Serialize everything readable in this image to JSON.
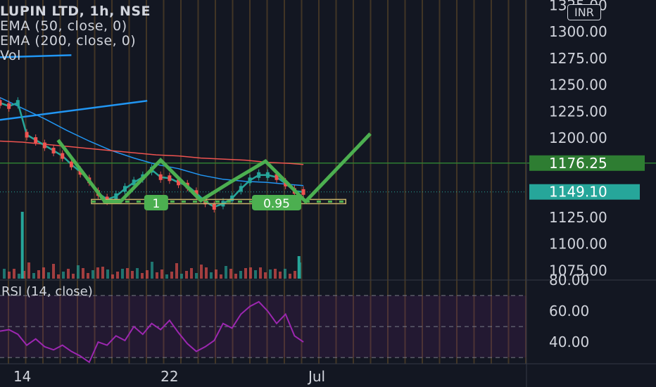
{
  "header": {
    "title": "LUPIN LTD, 1h, NSE",
    "indicators": [
      "EMA (50, close, 0)",
      "EMA (200, close, 0)",
      "Vol"
    ],
    "currency": "INR"
  },
  "rsi": {
    "label": "RSI (14, close)"
  },
  "chart_data": [
    {
      "type": "candlestick",
      "symbol": "LUPIN LTD",
      "interval": "1h",
      "exchange": "NSE",
      "currency": "INR",
      "x_ticks": [
        {
          "x": 0.2,
          "label": "14"
        },
        {
          "x": 3.5,
          "label": "22"
        },
        {
          "x": 6.8,
          "label": "Jul"
        }
      ],
      "xlim": [
        -0.3,
        11.5
      ],
      "ylim": [
        1066,
        1330
      ],
      "y_ticks": [
        1075,
        1100,
        1125,
        1150,
        1175,
        1200,
        1225,
        1250,
        1275,
        1300
      ],
      "y_tick_labels": [
        "1075.00",
        "1100.00",
        "1125.00",
        "1150.00",
        "1175.00",
        "1200.00",
        "1225.00",
        "1250.00",
        "1275.00",
        "1300.00"
      ],
      "partial_top_tick": {
        "value": 1325,
        "label": "1325.00"
      },
      "last_price": {
        "value": 1149.1,
        "label": "1149.10",
        "color": "#26a69a"
      },
      "resistance_line": {
        "value": 1176.25,
        "label": "1176.25",
        "color": "#2e7d32"
      },
      "series": [
        {
          "name": "EMA (50, close, 0)",
          "color": "#2196f3",
          "x": [
            -0.3,
            0.2,
            0.7,
            1.2,
            1.7,
            2.2,
            2.7,
            3.2,
            3.7,
            4.2,
            4.7,
            5.2,
            5.7,
            6.2,
            6.5
          ],
          "values": [
            1238,
            1228,
            1218,
            1207,
            1197,
            1188,
            1181,
            1175,
            1171,
            1165,
            1161,
            1159,
            1158,
            1156,
            1155
          ]
        },
        {
          "name": "EMA (200, close, 0)",
          "color": "#ef5350",
          "x": [
            -0.3,
            0.2,
            0.7,
            1.2,
            1.7,
            2.2,
            2.7,
            3.2,
            3.7,
            4.2,
            4.7,
            5.2,
            5.7,
            6.2,
            6.5
          ],
          "values": [
            1197,
            1196,
            1194,
            1192,
            1190,
            1188,
            1186,
            1184,
            1183,
            1181,
            1180,
            1179,
            1177,
            1176,
            1175
          ]
        },
        {
          "name": "Close",
          "color": "#26a69a",
          "x": [
            -0.3,
            -0.1,
            0.1,
            0.3,
            0.5,
            0.7,
            0.9,
            1.1,
            1.3,
            1.5,
            1.7,
            1.9,
            2.1,
            2.3,
            2.5,
            2.7,
            2.9,
            3.1,
            3.3,
            3.5,
            3.7,
            3.9,
            4.1,
            4.3,
            4.5,
            4.7,
            4.9,
            5.1,
            5.3,
            5.5,
            5.7,
            5.9,
            6.1,
            6.3,
            6.5
          ],
          "values": [
            1233,
            1230,
            1233,
            1203,
            1198,
            1193,
            1188,
            1183,
            1175,
            1168,
            1160,
            1148,
            1142,
            1145,
            1152,
            1158,
            1163,
            1170,
            1163,
            1162,
            1158,
            1155,
            1148,
            1140,
            1135,
            1138,
            1143,
            1152,
            1160,
            1165,
            1165,
            1163,
            1157,
            1150,
            1149
          ]
        }
      ],
      "trendlines": [
        {
          "color": "#2196f3",
          "x": [
            -0.3,
            1.3
          ],
          "values": [
            1276,
            1278
          ]
        },
        {
          "color": "#2196f3",
          "x": [
            -0.3,
            3.0
          ],
          "values": [
            1217,
            1235
          ]
        }
      ],
      "pattern": {
        "color": "#4caf50",
        "x": [
          1.0,
          2.05,
          2.4,
          3.3,
          4.2,
          4.85,
          5.65,
          6.55,
          8.0
        ],
        "values": [
          1198,
          1140,
          1140,
          1179,
          1141,
          1158,
          1178,
          1140,
          1204
        ]
      },
      "pattern_labels": [
        {
          "x": 3.2,
          "value": 1137,
          "label": "1"
        },
        {
          "x": 5.9,
          "value": 1137,
          "label": "0.95"
        }
      ],
      "neckline_box": {
        "x": [
          1.75,
          7.45
        ],
        "values": [
          1138,
          1142
        ]
      },
      "volume": {
        "color": "#26a69a",
        "x": [
          0.2,
          6.4
        ],
        "values": [
          95,
          32
        ]
      },
      "grid_vertical": true
    },
    {
      "type": "line",
      "title": "RSI (14, close)",
      "xlim": [
        -0.3,
        11.5
      ],
      "ylim": [
        26,
        80
      ],
      "y_ticks": [
        40,
        60,
        80
      ],
      "y_tick_labels": [
        "40.00",
        "60.00",
        "80.00"
      ],
      "bands": [
        70,
        50,
        30
      ],
      "series": [
        {
          "name": "RSI (14, close)",
          "color": "#9c27b0",
          "x": [
            -0.3,
            -0.1,
            0.1,
            0.3,
            0.5,
            0.7,
            0.9,
            1.1,
            1.3,
            1.5,
            1.7,
            1.9,
            2.1,
            2.3,
            2.5,
            2.7,
            2.9,
            3.1,
            3.3,
            3.5,
            3.7,
            3.9,
            4.1,
            4.3,
            4.5,
            4.7,
            4.9,
            5.1,
            5.3,
            5.5,
            5.7,
            5.9,
            6.1,
            6.3,
            6.5
          ],
          "values": [
            47,
            48,
            45,
            38,
            42,
            37,
            35,
            38,
            34,
            31,
            27,
            40,
            38,
            44,
            41,
            50,
            45,
            52,
            48,
            54,
            46,
            39,
            34,
            37,
            41,
            52,
            49,
            58,
            63,
            66,
            60,
            52,
            58,
            44,
            40
          ]
        }
      ],
      "grid_vertical": true
    }
  ]
}
